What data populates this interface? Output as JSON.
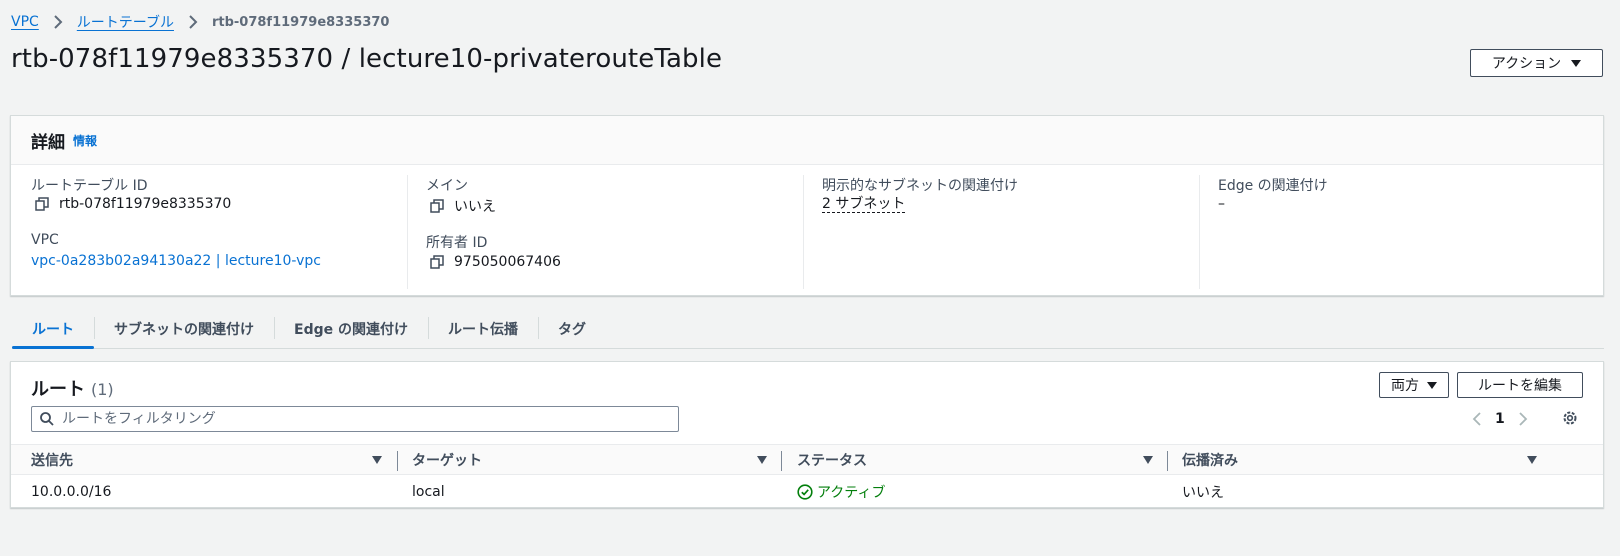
{
  "breadcrumb": {
    "items": [
      "VPC",
      "ルートテーブル"
    ],
    "current": "rtb-078f11979e8335370"
  },
  "page": {
    "title": "rtb-078f11979e8335370 / lecture10-privaterouteTable",
    "actions_label": "アクション"
  },
  "details": {
    "heading": "詳細",
    "info_link": "情報",
    "route_table_id_label": "ルートテーブル ID",
    "route_table_id": "rtb-078f11979e8335370",
    "vpc_label": "VPC",
    "vpc_value": "vpc-0a283b02a94130a22 | lecture10-vpc",
    "main_label": "メイン",
    "main_value": "いいえ",
    "owner_label": "所有者 ID",
    "owner_value": "975050067406",
    "explicit_subnet_label": "明示的なサブネットの関連付け",
    "explicit_subnet_value": "2 サブネット",
    "edge_label": "Edge の関連付け",
    "edge_value": "–"
  },
  "tabs": [
    {
      "label": "ルート",
      "active": true
    },
    {
      "label": "サブネットの関連付け",
      "active": false
    },
    {
      "label": "Edge の関連付け",
      "active": false
    },
    {
      "label": "ルート伝播",
      "active": false
    },
    {
      "label": "タグ",
      "active": false
    }
  ],
  "routes": {
    "heading": "ルート",
    "count": "(1)",
    "direction_select": "両方",
    "edit_label": "ルートを編集",
    "filter_placeholder": "ルートをフィルタリング",
    "page_number": "1",
    "columns": [
      "送信先",
      "ターゲット",
      "ステータス",
      "伝播済み"
    ],
    "rows": [
      {
        "destination": "10.0.0.0/16",
        "target": "local",
        "status": "アクティブ",
        "propagated": "いいえ"
      }
    ]
  },
  "colors": {
    "link": "#0972d3",
    "success": "#037f0c",
    "background": "#f2f3f3"
  }
}
